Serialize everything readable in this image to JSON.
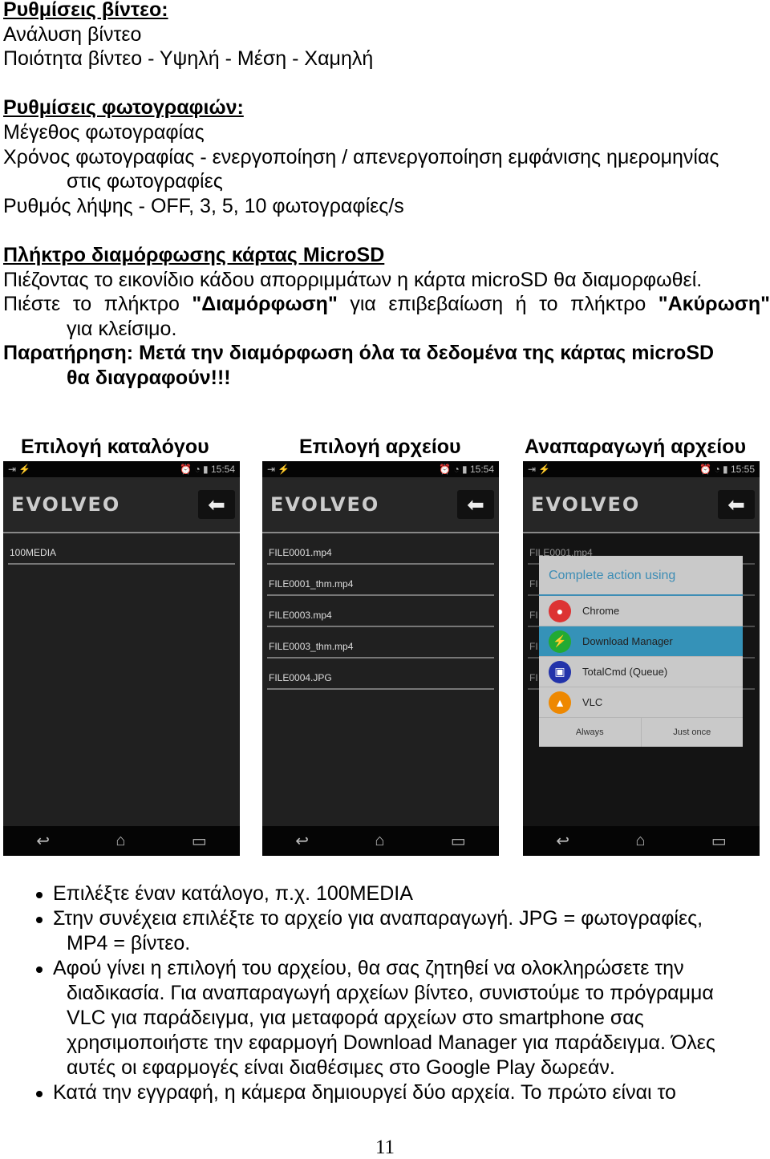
{
  "sections": {
    "video_heading": "Ρυθμίσεις βίντεο:",
    "video_lines": [
      "Ανάλυση βίντεο",
      "Ποιότητα βίντεο - Υψηλή - Μέση - Χαμηλή"
    ],
    "photo_heading": "Ρυθμίσεις φωτογραφιών:",
    "photo_line1": "Μέγεθος φωτογραφίας",
    "photo_line2a": "Χρόνος φωτογραφίας - ενεργοποίηση / απενεργοποίηση εμφάνισης ημερομηνίας",
    "photo_line2b": "στις φωτογραφίες",
    "photo_line3": "Ρυθμός λήψης - OFF, 3, 5, 10 φωτογραφίες/s",
    "format_heading": "Πλήκτρο διαμόρφωσης κάρτας MicroSD",
    "format_line1": "Πιέζοντας το εικονίδιο κάδου απορριμμάτων η κάρτα microSD θα διαμορφωθεί.",
    "format_line2_pre": "Πιέστε το πλήκτρο ",
    "format_line2_b1": "\"Διαμόρφωση\"",
    "format_line2_mid": " για επιβεβαίωση ή το πλήκτρο ",
    "format_line2_b2": "\"Ακύρωση\"",
    "format_line3": "για κλείσιμο.",
    "note_a": "Παρατήρηση: Μετά την διαμόρφωση όλα τα δεδομένα της κάρτας microSD",
    "note_b": "θα διαγραφούν!!!"
  },
  "captions": [
    "Επιλογή καταλόγου",
    "Επιλογή αρχείου",
    "Αναπαραγωγή αρχείου"
  ],
  "phones": [
    {
      "time": "15:54",
      "logo": "EVOLVEO",
      "items": [
        "100MEDIA"
      ]
    },
    {
      "time": "15:54",
      "logo": "EVOLVEO",
      "items": [
        "FILE0001.mp4",
        "FILE0001_thm.mp4",
        "FILE0003.mp4",
        "FILE0003_thm.mp4",
        "FILE0004.JPG"
      ]
    },
    {
      "time": "15:55",
      "logo": "EVOLVEO",
      "items": [
        "FILE0001.mp4",
        "FI",
        "FI",
        "FI",
        "FI"
      ],
      "dialog": {
        "title": "Complete action using",
        "apps": [
          "Chrome",
          "Download Manager",
          "TotalCmd (Queue)",
          "VLC"
        ],
        "selected": "Download Manager",
        "always": "Always",
        "just_once": "Just once"
      }
    }
  ],
  "bullets": {
    "b1": "Επιλέξτε έναν κατάλογο, π.χ. 100MEDIA",
    "b2a": "Στην συνέχεια επιλέξτε το αρχείο για αναπαραγωγή. JPG = φωτογραφίες,",
    "b2b": "MP4 = βίντεο.",
    "b3a": "Αφού γίνει η επιλογή του αρχείου, θα σας ζητηθεί να ολοκληρώσετε την",
    "b3b": "διαδικασία. Για αναπαραγωγή αρχείων βίντεο, συνιστούμε το πρόγραμμα",
    "b3c": "VLC για παράδειγμα, για μεταφορά αρχείων στο smartphone σας",
    "b3d": "χρησιμοποιήστε την εφαρμογή Download Manager για παράδειγμα. Όλες",
    "b3e": "αυτές οι εφαρμογές είναι διαθέσιμες στο Google Play δωρεάν.",
    "b4": "Κατά την εγγραφή, η κάμερα δημιουργεί δύο αρχεία. Το πρώτο είναι το"
  },
  "page_number": "11",
  "colors": {
    "dialog_accent": "#3d8db5",
    "selected_row": "#3592b8"
  }
}
